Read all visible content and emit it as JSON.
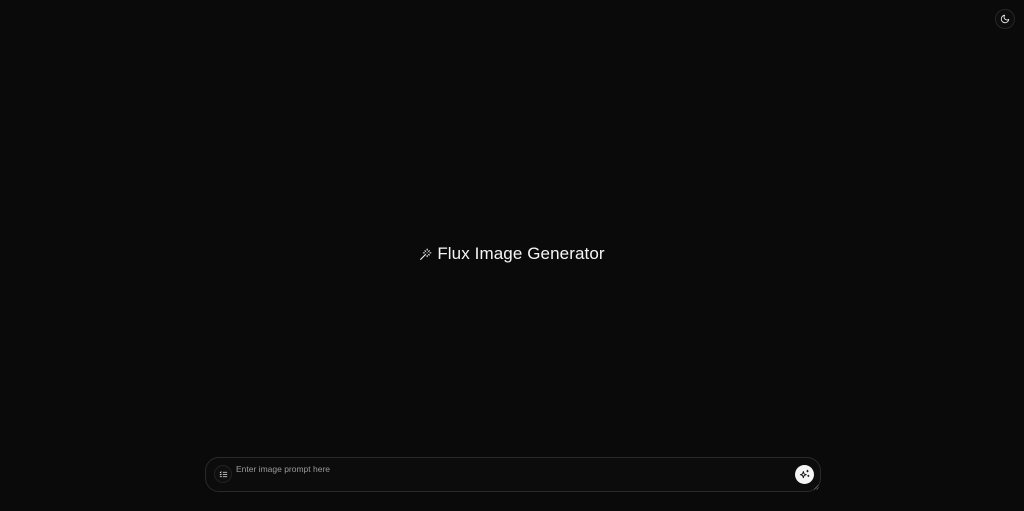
{
  "app": {
    "title": "Flux Image Generator"
  },
  "header": {
    "theme_toggle_icon": "moon-icon"
  },
  "hero": {
    "icon": "magic-wand-icon",
    "title": "Flux Image Generator"
  },
  "prompt": {
    "placeholder": "Enter image prompt here",
    "value": "",
    "options_icon": "list-settings-icon",
    "generate_icon": "sparkles-icon"
  },
  "colors": {
    "background": "#0a0a0a",
    "text": "#f5f5f5",
    "placeholder": "#9a9a9a",
    "border": "#2a2a2a",
    "generate_button_bg": "#f5f5f5"
  }
}
